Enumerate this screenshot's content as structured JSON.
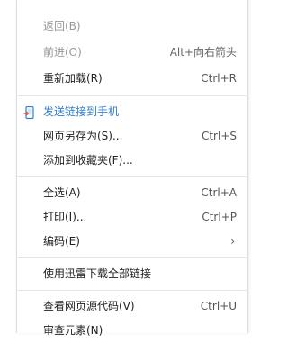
{
  "menu": {
    "back": {
      "label": "返回(B)"
    },
    "forward": {
      "label": "前进(O)",
      "shortcut": "Alt+向右箭头"
    },
    "reload": {
      "label": "重新加载(R)",
      "shortcut": "Ctrl+R"
    },
    "send_link": {
      "label": "发送链接到手机",
      "icon": "phone-send-icon"
    },
    "save_as": {
      "label": "网页另存为(S)...",
      "shortcut": "Ctrl+S"
    },
    "add_favorite": {
      "label": "添加到收藏夹(F)..."
    },
    "select_all": {
      "label": "全选(A)",
      "shortcut": "Ctrl+A"
    },
    "print": {
      "label": "打印(I)...",
      "shortcut": "Ctrl+P"
    },
    "encoding": {
      "label": "编码(E)",
      "submenu_arrow": "›"
    },
    "download_all": {
      "label": "使用迅雷下载全部链接"
    },
    "view_source": {
      "label": "查看网页源代码(V)",
      "shortcut": "Ctrl+U"
    },
    "inspect": {
      "label": "审查元素(N)"
    }
  },
  "colors": {
    "link": "#2f7fd1",
    "disabled": "#9a9a9a",
    "separator": "#e4e4e4"
  }
}
